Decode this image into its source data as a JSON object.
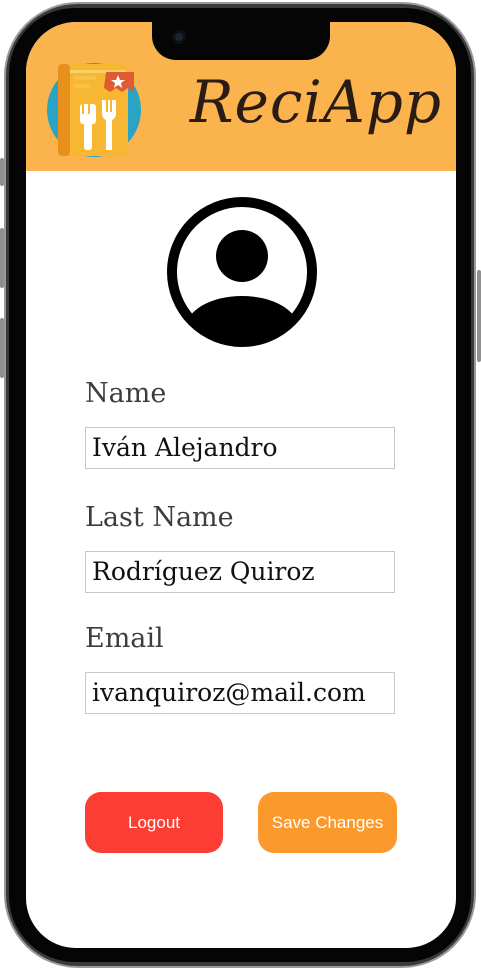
{
  "header": {
    "app_title": "ReciApp",
    "background_color": "#fbb34d",
    "logo_icon": "recipe-book-icon"
  },
  "profile": {
    "avatar_icon": "user-avatar-icon"
  },
  "form": {
    "name_label": "Name",
    "name_value": "Iván Alejandro",
    "last_name_label": "Last Name",
    "last_name_value": "Rodríguez Quiroz",
    "email_label": "Email",
    "email_value": "ivanquiroz@mail.com"
  },
  "actions": {
    "logout_label": "Logout",
    "logout_color": "#fb3d33",
    "save_label": "Save Changes",
    "save_color": "#fb992c"
  }
}
